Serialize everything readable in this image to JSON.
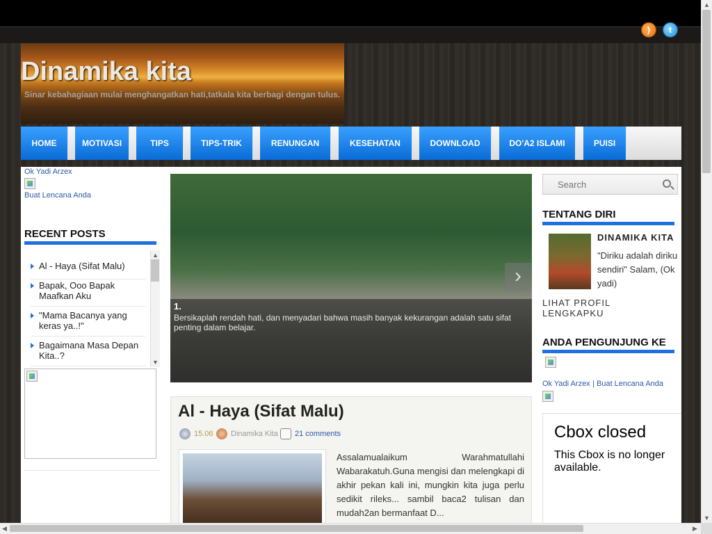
{
  "site": {
    "title": "Dinamika kita",
    "description": "Sinar kebahagiaan mulai menghangatkan hati,tatkala kita berbagi dengan tulus."
  },
  "social": {
    "rss_icon": "rss-icon",
    "twitter_icon": "twitter-icon",
    "twitter_glyph": "t"
  },
  "nav": [
    "HOME",
    "MOTIVASI",
    "TIPS",
    "TIPS-TRIK",
    "RENUNGAN",
    "KESEHATAN",
    "DOWNLOAD",
    "DO'A2 ISLAMI",
    "PUISI"
  ],
  "left": {
    "badge_owner": "Ok Yadi Arzex",
    "badge_link": "Buat Lencana Anda",
    "recent_title": "RECENT POSTS",
    "recent_posts": [
      "Al - Haya (Sifat Malu)",
      "Bapak, Ooo Bapak Maafkan Aku",
      "\"Mama Bacanya yang keras ya..!\"",
      "Bagaimana Masa Depan Kita..?"
    ]
  },
  "slider": {
    "number": "1.",
    "caption": "Bersikaplah rendah hati, dan menyadari bahwa masih banyak kekurangan adalah satu sifat penting dalam belajar.",
    "next_glyph": "›"
  },
  "post": {
    "title": "Al - Haya (Sifat Malu)",
    "time": "15.06",
    "author": "Dinamika Kita",
    "comments": "21 comments",
    "excerpt": "Assalamualaikum Warahmatullahi Wabarakatuh.Guna mengisi dan melengkapi di akhir pekan kali ini, mungkin kita juga perlu sedikit rileks... sambil baca2 tulisan dan mudah2an bermanfaat D..."
  },
  "right": {
    "search_placeholder": "Search",
    "about_title": "TENTANG DIRI",
    "profile_name": "DINAMIKA KITA",
    "profile_quote": "\"Diriku adalah diriku sendiri\" Salam, (Ok yadi)",
    "profile_link": "LIHAT PROFIL LENGKAPKU",
    "visitor_title": "ANDA PENGUNJUNG KE",
    "badge_owner": "Ok Yadi Arzex",
    "badge_sep": "|",
    "badge_link": "Buat Lencana Anda",
    "cbox_title": "Cbox closed",
    "cbox_text": "This Cbox is no longer available."
  },
  "scrollbars": {
    "up": "▲",
    "down": "▼",
    "left": "◀",
    "right": "▶"
  },
  "colors": {
    "nav_blue": "#1f6fe0",
    "accent": "#1f6fe0"
  }
}
